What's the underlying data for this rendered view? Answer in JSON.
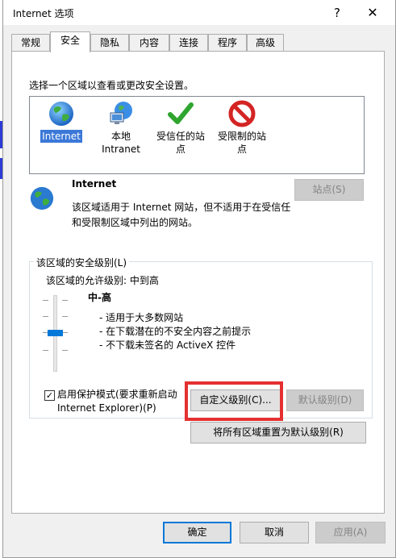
{
  "window": {
    "title": "Internet 选项",
    "help_glyph": "?",
    "close_glyph": "✕"
  },
  "tabs": [
    {
      "label": "常规"
    },
    {
      "label": "安全"
    },
    {
      "label": "隐私"
    },
    {
      "label": "内容"
    },
    {
      "label": "连接"
    },
    {
      "label": "程序"
    },
    {
      "label": "高级"
    }
  ],
  "active_tab": "安全",
  "security": {
    "zone_prompt": "选择一个区域以查看或更改安全设置。",
    "zones": [
      {
        "label_line1": "Internet",
        "label_line2": "",
        "icon": "globe-icon",
        "selected": true
      },
      {
        "label_line1": "本地",
        "label_line2": "Intranet",
        "icon": "local-intranet-icon",
        "selected": false
      },
      {
        "label_line1": "受信任的站",
        "label_line2": "点",
        "icon": "checkmark-icon",
        "selected": false
      },
      {
        "label_line1": "受限制的站",
        "label_line2": "点",
        "icon": "restricted-icon",
        "selected": false
      }
    ],
    "zone_info": {
      "title": "Internet",
      "description": "该区域适用于 Internet 网站，但不适用于在受信任和受限制区域中列出的网站。"
    },
    "sites_button": "站点(S)",
    "level_group_label": "该区域的安全级别(L)",
    "allowed_levels": "该区域的允许级别: 中到高",
    "level_name": "中-高",
    "level_details": [
      "- 适用于大多数网站",
      "- 在下载潜在的不安全内容之前提示",
      "- 不下载未签名的 ActiveX 控件"
    ],
    "slider_level": "中-高",
    "protected_mode": {
      "checked": true,
      "label_line1": "启用保护模式(要求重新启动",
      "label_line2": "Internet Explorer)(P)"
    },
    "custom_level_button": "自定义级别(C)...",
    "default_level_button": "默认级别(D)",
    "reset_all_button": "将所有区域重置为默认级别(R)"
  },
  "footer": {
    "ok": "确定",
    "cancel": "取消",
    "apply": "应用(A)"
  },
  "colors": {
    "accent": "#0078d7",
    "highlight_box": "#e53030",
    "selection": "#3b78d8"
  }
}
